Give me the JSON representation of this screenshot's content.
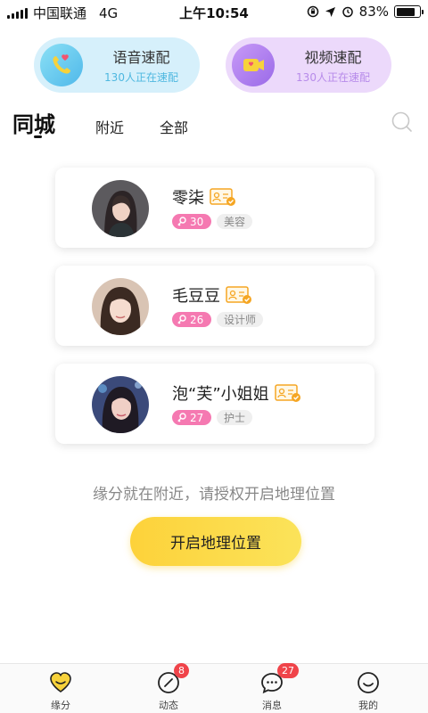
{
  "status_bar": {
    "carrier": "中国联通",
    "network": "4G",
    "time": "上午10:54",
    "battery": "83%",
    "battery_level": 0.83
  },
  "speed_match": {
    "voice": {
      "title": "语音速配",
      "subtitle": "130人正在速配"
    },
    "video": {
      "title": "视频速配",
      "subtitle": "130人正在速配"
    }
  },
  "tabs": [
    {
      "label": "同城",
      "active": true
    },
    {
      "label": "附近",
      "active": false
    },
    {
      "label": "全部",
      "active": false
    }
  ],
  "users": [
    {
      "name": "零柒",
      "age": "30",
      "job": "美容"
    },
    {
      "name": "毛豆豆",
      "age": "26",
      "job": "设计师"
    },
    {
      "name": "泡“芙”小姐姐",
      "age": "27",
      "job": "护士"
    }
  ],
  "location_prompt": {
    "text": "缘分就在附近，请授权开启地理位置",
    "button": "开启地理位置"
  },
  "bottom_nav": [
    {
      "label": "缘分",
      "icon": "heart-icon",
      "active": true
    },
    {
      "label": "动态",
      "icon": "compass-icon",
      "badge": "8"
    },
    {
      "label": "消息",
      "icon": "chat-icon",
      "badge": "27"
    },
    {
      "label": "我的",
      "icon": "smiley-icon"
    }
  ],
  "colors": {
    "accent_yellow": "#fdd23a",
    "age_tag_pink": "#f579b1",
    "badge_red": "#f0444a",
    "verified_orange": "#f5a623"
  }
}
